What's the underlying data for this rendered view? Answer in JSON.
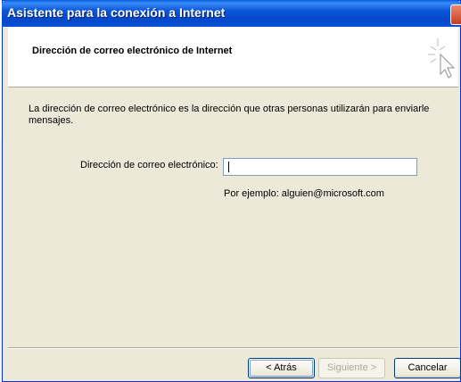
{
  "window": {
    "title": "Asistente para la conexión a Internet"
  },
  "header": {
    "title": "Dirección de correo electrónico de Internet",
    "icon": "wizard-cursor-icon"
  },
  "content": {
    "description": "La dirección de correo electrónico es la dirección que otras personas utilizarán para enviarle mensajes.",
    "email_label": "Dirección de correo electrónico:",
    "email_value": "",
    "example": "Por ejemplo: alguien@microsoft.com"
  },
  "buttons": {
    "back": "< Atrás",
    "next": "Siguiente >",
    "cancel": "Cancelar"
  },
  "colors": {
    "titlebar": "#0a56d8",
    "dialog_bg": "#ece9d8",
    "disabled_text": "#aca899"
  }
}
